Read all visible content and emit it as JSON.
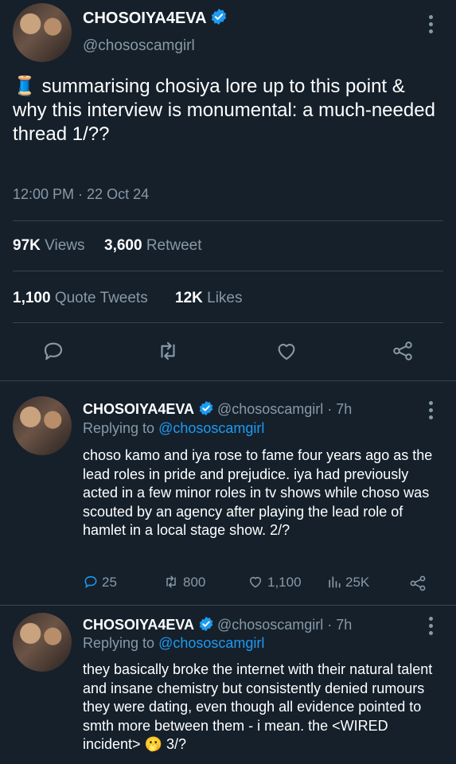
{
  "main_tweet": {
    "display_name": "CHOSOIYA4EVA",
    "handle": "@chososcamgirl",
    "emoji": "🧵",
    "text": "summarising chosiya lore up to this point & why this interview is monumental: a much-needed thread 1/??",
    "timestamp": "12:00 PM · 22 Oct 24",
    "stats": {
      "views_count": "97K",
      "views_label": "Views",
      "retweets_count": "3,600",
      "retweets_label": "Retweet",
      "quotes_count": "1,100",
      "quotes_label": "Quote Tweets",
      "likes_count": "12K",
      "likes_label": "Likes"
    }
  },
  "replies": [
    {
      "display_name": "CHOSOIYA4EVA",
      "handle_time": "@chososcamgirl · 7h",
      "replying_prefix": "Replying to",
      "replying_to": "@chososcamgirl",
      "text": "choso kamo and iya rose to fame four years ago as the lead roles in pride and prejudice. iya had previously acted in a few minor roles in tv shows while choso was scouted by an agency after playing the lead role of hamlet in a local stage show. 2/?",
      "metrics": {
        "replies": "25",
        "retweets": "800",
        "likes": "1,100",
        "views": "25K"
      }
    },
    {
      "display_name": "CHOSOIYA4EVA",
      "handle_time": "@chososcamgirl · 7h",
      "replying_prefix": "Replying to",
      "replying_to": "@chososcamgirl",
      "text": "they basically broke the internet with their natural talent and insane chemistry but consistently denied rumours they were dating, even though all evidence pointed to smth more between them - i mean. the <WIRED incident>",
      "emoji": "🫢",
      "suffix": "3/?"
    }
  ],
  "colors": {
    "background": "#15202b",
    "muted": "#8899a6",
    "accent": "#1d9bf0",
    "divider": "#38444d"
  }
}
